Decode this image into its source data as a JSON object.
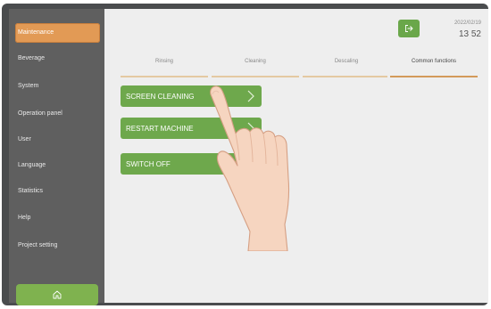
{
  "sidebar": {
    "items": [
      {
        "label": "Maintenance",
        "active": true
      },
      {
        "label": "Beverage",
        "active": false
      },
      {
        "label": "System",
        "active": false
      },
      {
        "label": "Operation panel",
        "active": false
      },
      {
        "label": "User",
        "active": false
      },
      {
        "label": "Language",
        "active": false
      },
      {
        "label": "Statistics",
        "active": false
      },
      {
        "label": "Help",
        "active": false
      },
      {
        "label": "Project setting",
        "active": false
      }
    ],
    "home_icon": "home-icon"
  },
  "header": {
    "exit_icon": "exit-icon",
    "date": "2022/02/19",
    "time": "13 52"
  },
  "tabs": [
    {
      "label": "Rinsing",
      "active": false
    },
    {
      "label": "Cleaning",
      "active": false
    },
    {
      "label": "Descaling",
      "active": false
    },
    {
      "label": "Common functions",
      "active": true
    }
  ],
  "functions": [
    {
      "label": "SCREEN CLEANING"
    },
    {
      "label": "RESTART MACHINE"
    },
    {
      "label": "SWITCH OFF"
    }
  ],
  "colors": {
    "accent_orange": "#e29a55",
    "button_green": "#6ea84c",
    "sidebar_bg": "#5f5f5f",
    "frame_bg": "#4a4c4e"
  }
}
